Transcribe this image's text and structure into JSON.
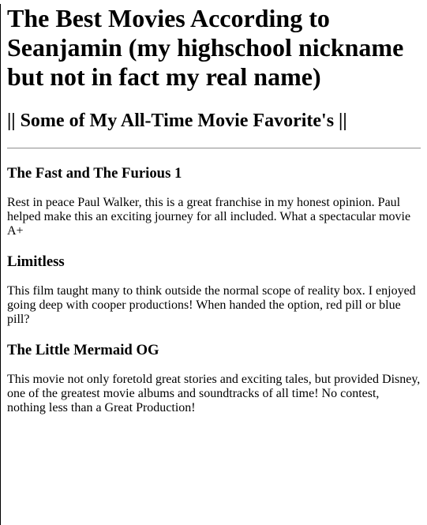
{
  "page": {
    "title": "The Best Movies According to Seanjamin (my highschool nickname but not in fact my real name)",
    "subtitle": "|| Some of My All-Time Movie Favorite's ||"
  },
  "movies": [
    {
      "title": "The Fast and The Furious 1",
      "description": "Rest in peace Paul Walker, this is a great franchise in my honest opinion. Paul helped make this an exciting journey for all included. What a spectacular movie A+"
    },
    {
      "title": "Limitless",
      "description": "This film taught many to think outside the normal scope of reality box. I enjoyed going deep with cooper productions! When handed the option, red pill or blue pill?"
    },
    {
      "title": "The Little Mermaid OG",
      "description": "This movie not only foretold great stories and exciting tales, but provided Disney, one of the greatest movie albums and soundtracks of all time! No contest, nothing less than a Great Production!"
    }
  ]
}
